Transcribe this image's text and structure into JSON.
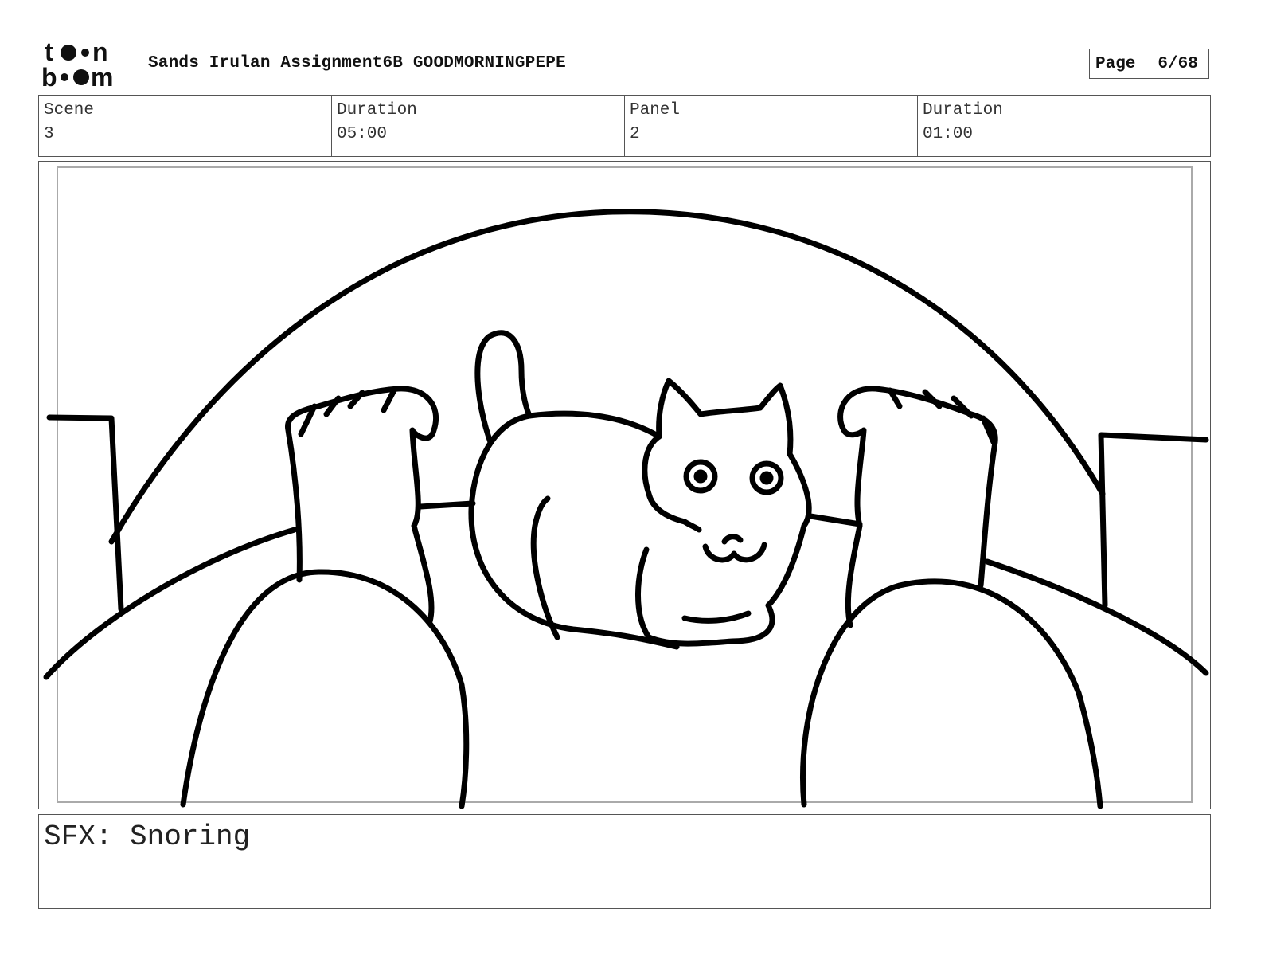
{
  "header": {
    "logo_text": "toon boom",
    "title": "Sands Irulan Assignment6B GOODMORNINGPEPE",
    "page_label": "Page",
    "page_number": "6/68"
  },
  "info": {
    "scene_label": "Scene",
    "scene_value": "3",
    "scene_duration_label": "Duration",
    "scene_duration_value": "05:00",
    "panel_label": "Panel",
    "panel_value": "2",
    "panel_duration_label": "Duration",
    "panel_duration_value": "01:00"
  },
  "panel": {
    "illustration_icon": "sketch-cat-on-bed-illustration"
  },
  "notes": {
    "text": "SFX: Snoring"
  }
}
